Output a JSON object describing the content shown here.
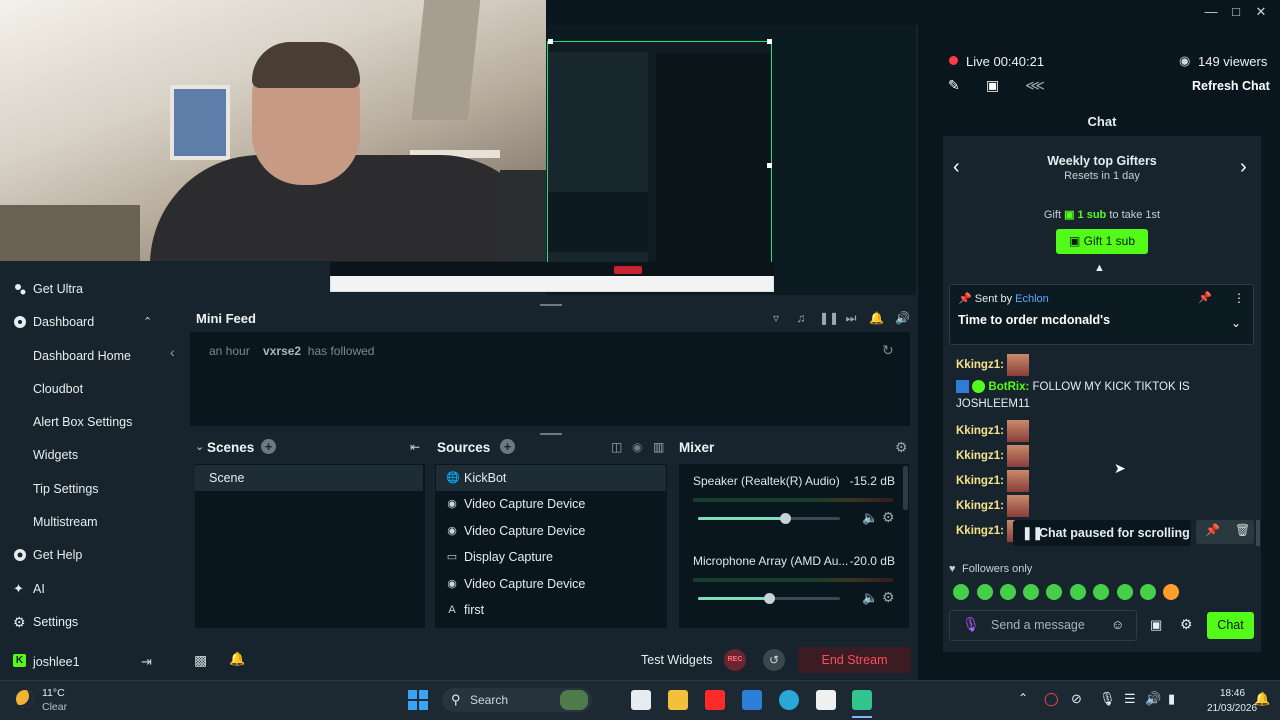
{
  "colors": {
    "accent_green": "#53fc18",
    "live_red": "#ff3b4a",
    "panel": "#09161d",
    "bg": "#17242d"
  },
  "sidebar": {
    "items": [
      {
        "label": "Get Ultra",
        "icon": "ultra-icon"
      },
      {
        "label": "Dashboard",
        "icon": "dashboard-icon"
      },
      {
        "label": "Dashboard Home"
      },
      {
        "label": "Cloudbot"
      },
      {
        "label": "Alert Box Settings"
      },
      {
        "label": "Widgets"
      },
      {
        "label": "Tip Settings"
      },
      {
        "label": "Multistream"
      },
      {
        "label": "Get Help",
        "icon": "help-icon"
      },
      {
        "label": "AI",
        "icon": "ai-sparkle-icon"
      },
      {
        "label": "Settings",
        "icon": "gear-icon"
      }
    ],
    "user": "joshlee1"
  },
  "minifeed": {
    "title": "Mini Feed",
    "events": [
      {
        "time": "an hour",
        "user": "vxrse2",
        "action": "has followed"
      }
    ]
  },
  "scenes": {
    "title": "Scenes",
    "items": [
      "Scene"
    ]
  },
  "sources": {
    "title": "Sources",
    "items": [
      {
        "label": "KickBot",
        "icon": "globe-icon"
      },
      {
        "label": "Video Capture Device",
        "icon": "webcam-icon"
      },
      {
        "label": "Video Capture Device",
        "icon": "webcam-icon"
      },
      {
        "label": "Display Capture",
        "icon": "monitor-icon"
      },
      {
        "label": "Video Capture Device",
        "icon": "webcam-icon"
      },
      {
        "label": "first",
        "icon": "text-icon"
      }
    ]
  },
  "mixer": {
    "title": "Mixer",
    "channels": [
      {
        "name": "Speaker (Realtek(R) Audio)",
        "db": "-15.2 dB",
        "level": 0.61
      },
      {
        "name": "Microphone Array (AMD Au...",
        "db": "-20.0 dB",
        "level": 0.5
      }
    ]
  },
  "bottombar": {
    "test_widgets": "Test Widgets",
    "rec": "REC",
    "end_stream": "End Stream"
  },
  "chat": {
    "live": "Live 00:40:21",
    "viewers": "149 viewers",
    "refresh": "Refresh Chat",
    "title": "Chat",
    "gifters_title": "Weekly top Gifters",
    "gifters_sub": "Resets in 1 day",
    "gift_prefix": "Gift",
    "gift_amount": "1 sub",
    "gift_suffix": "to take 1st",
    "gift_button": "Gift 1 sub",
    "pinned_prefix": "Sent by",
    "pinned_user": "Echlon",
    "pinned_message": "Time to order mcdonald's",
    "messages": [
      {
        "user": "Kkingz1:",
        "text": ""
      },
      {
        "user": "BotRix:",
        "text": "FOLLOW MY KICK TIKTOK IS JOSHLEEM11"
      },
      {
        "user": "Kkingz1:",
        "text": ""
      },
      {
        "user": "Kkingz1:",
        "text": ""
      },
      {
        "user": "Kkingz1:",
        "text": ""
      },
      {
        "user": "Kkingz1:",
        "text": ""
      },
      {
        "user": "Kkingz1:",
        "text": ""
      }
    ],
    "paused": "Chat paused for scrolling",
    "followers_only": "Followers only",
    "input_placeholder": "Send a message",
    "send": "Chat"
  },
  "taskbar": {
    "weather_temp": "11°C",
    "weather_desc": "Clear",
    "search": "Search",
    "time": "18:46",
    "date": "21/03/2026"
  }
}
